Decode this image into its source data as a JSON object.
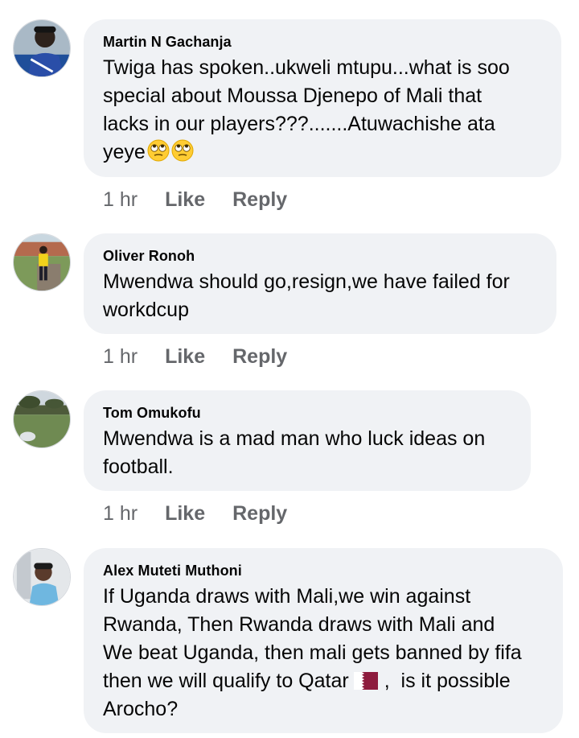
{
  "comments": [
    {
      "author": "Martin N Gachanja",
      "text_lines": [
        "Twiga has spoken..ukweli mtupu...what is soo",
        "special about Moussa Djenepo of Mali that",
        "lacks in our players???.......Atuwachishe ata",
        "yeye"
      ],
      "emoji": [
        "face-with-rolling-eyes-icon",
        "face-with-rolling-eyes-icon"
      ],
      "time": "1 hr",
      "like": "Like",
      "reply": "Reply"
    },
    {
      "author": "Oliver Ronoh",
      "text_lines": [
        "Mwendwa should go,resign,we have failed for",
        "workdcup"
      ],
      "time": "1 hr",
      "like": "Like",
      "reply": "Reply"
    },
    {
      "author": "Tom Omukofu",
      "text_lines": [
        "Mwendwa is a mad man who luck ideas on",
        "football."
      ],
      "time": "1 hr",
      "like": "Like",
      "reply": "Reply"
    },
    {
      "author": "Alex Muteti Muthoni",
      "text_lines": [
        "If Uganda draws with Mali,we win against",
        "Rwanda, Then Rwanda draws with Mali and",
        "We beat Uganda, then mali gets banned by fifa",
        "then we will qualify to Qatar",
        ",  is it possible",
        "Arocho?"
      ],
      "flag_icon": "qatar-flag-icon"
    }
  ],
  "colors": {
    "bubble": "#f0f2f5",
    "meta": "#65676b",
    "text": "#050505"
  }
}
